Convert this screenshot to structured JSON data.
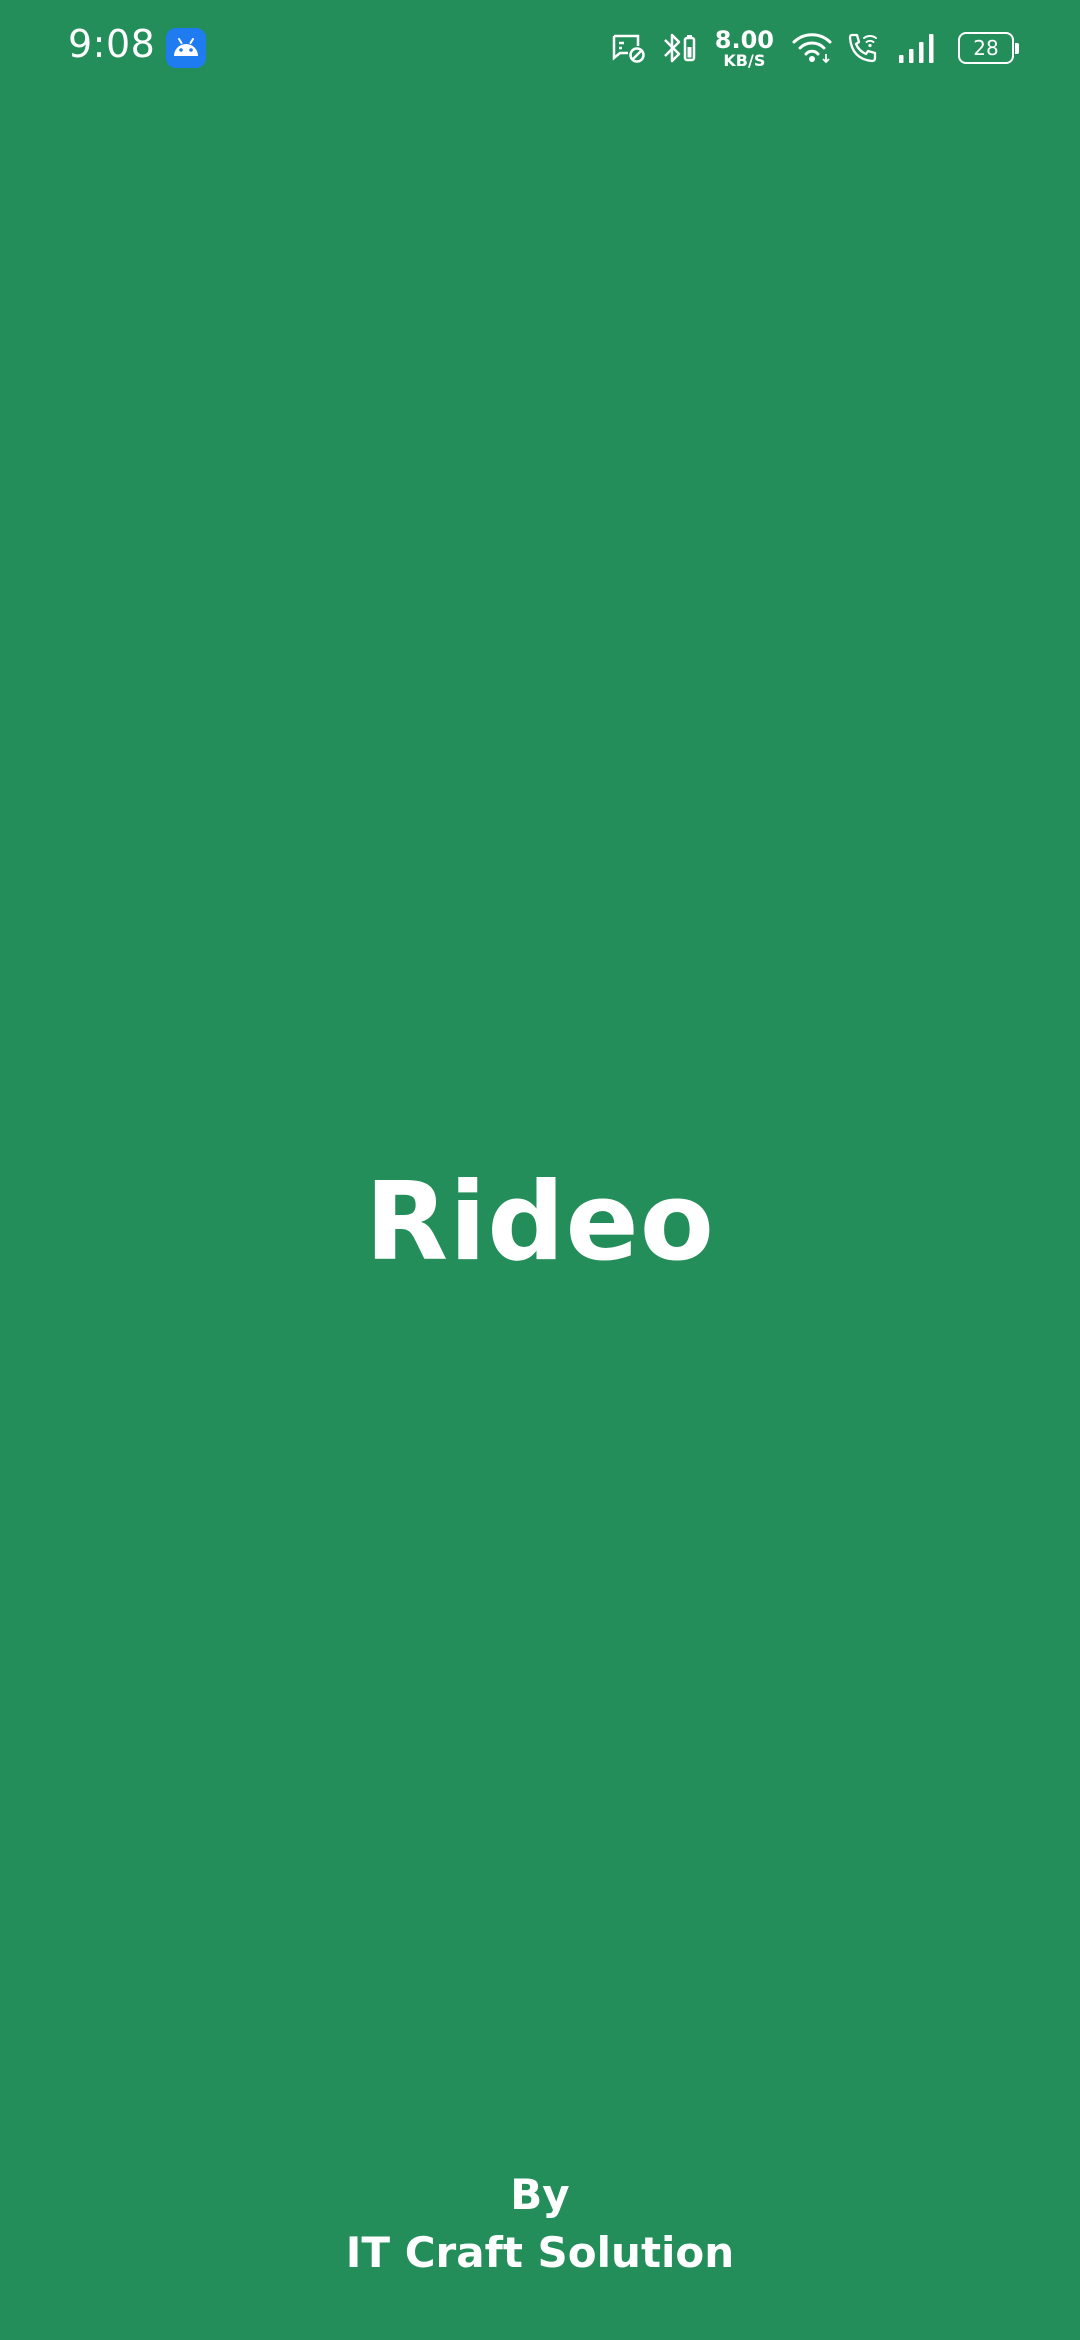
{
  "status_bar": {
    "time": "9:08",
    "app_notification_icon": "android-icon",
    "icons": [
      "screenshot-blocked-icon",
      "bluetooth-battery-icon",
      "wifi-icon",
      "wifi-calling-icon",
      "cellular-signal-icon"
    ],
    "network_speed": {
      "value": "8.00",
      "unit": "KB/S"
    },
    "battery_level": "28"
  },
  "splash": {
    "title": "Rideo",
    "by_label": "By",
    "company": "IT Craft Solution"
  },
  "colors": {
    "background": "#238e59",
    "text": "#ffffff",
    "notification_icon_bg": "#1f7cf0"
  }
}
